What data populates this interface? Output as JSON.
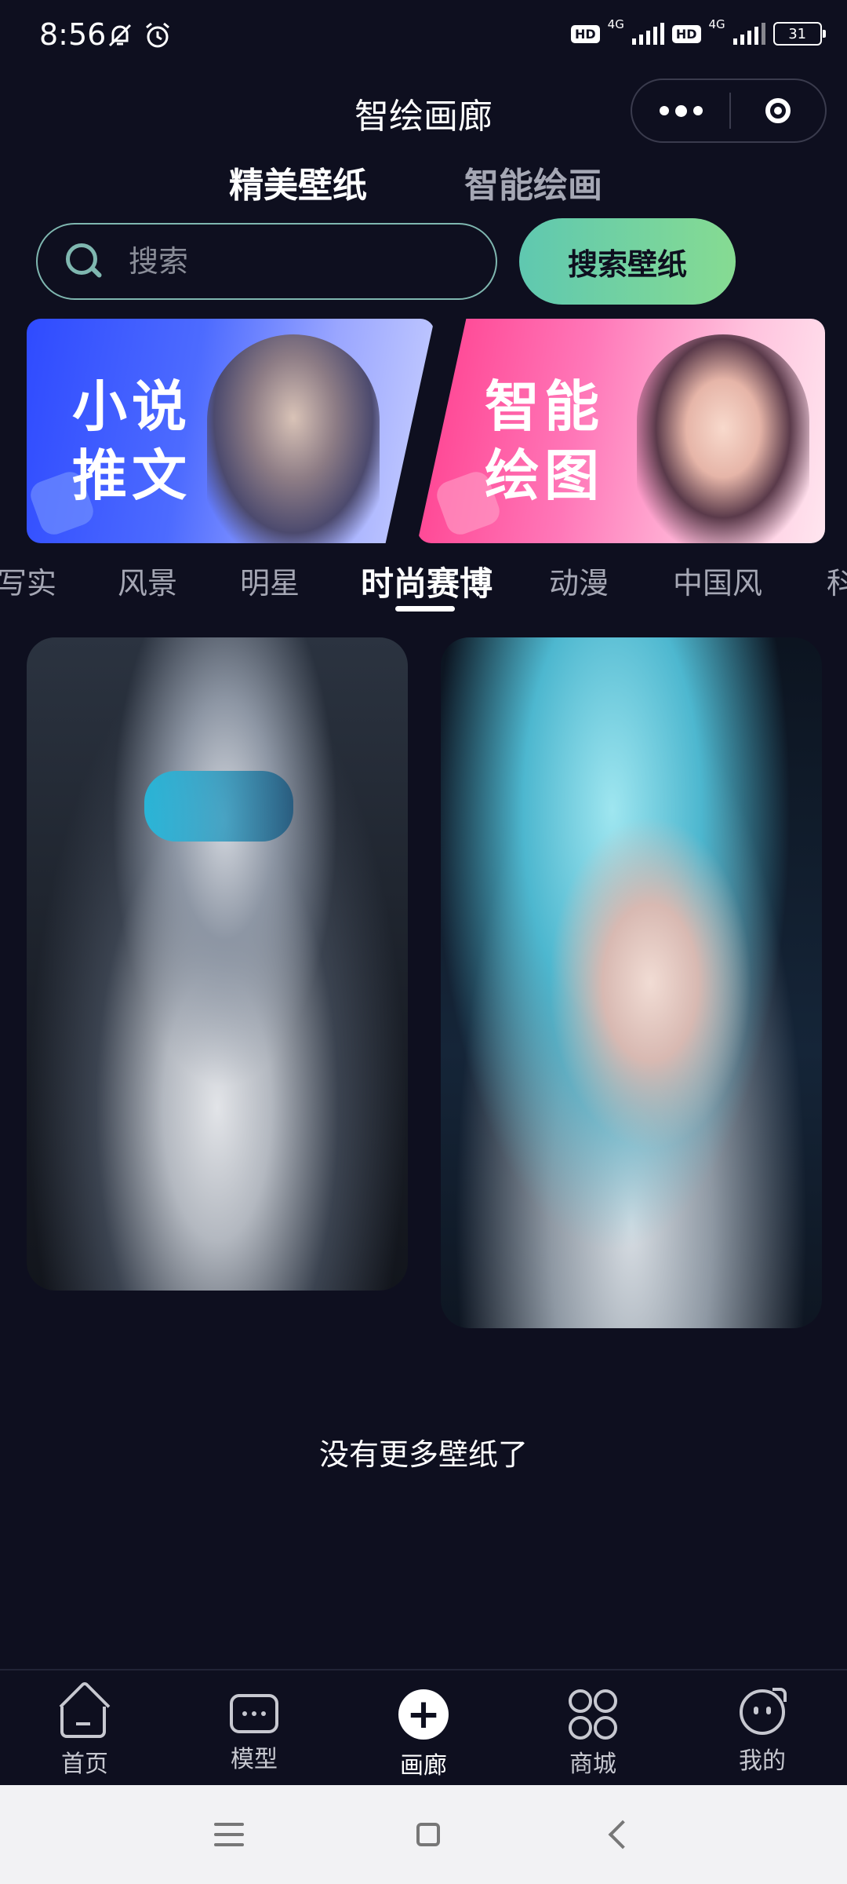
{
  "status_bar": {
    "time": "8:56",
    "hd1": "HD",
    "net1": "4G",
    "hd2": "HD",
    "net2": "4G",
    "battery": "31"
  },
  "header": {
    "title": "智绘画廊"
  },
  "top_tabs": [
    {
      "label": "精美壁纸",
      "active": true
    },
    {
      "label": "智能绘画",
      "active": false
    }
  ],
  "search": {
    "placeholder": "搜索",
    "value": "",
    "button_label": "搜索壁纸"
  },
  "banners": [
    {
      "line1": "小说",
      "line2": "推文"
    },
    {
      "line1": "智能",
      "line2": "绘图"
    }
  ],
  "categories": [
    {
      "label": "写实",
      "active": false
    },
    {
      "label": "风景",
      "active": false
    },
    {
      "label": "明星",
      "active": false
    },
    {
      "label": "时尚赛博",
      "active": true
    },
    {
      "label": "动漫",
      "active": false
    },
    {
      "label": "中国风",
      "active": false
    },
    {
      "label": "科",
      "active": false
    }
  ],
  "gallery": {
    "end_message": "没有更多壁纸了"
  },
  "bottom_nav": [
    {
      "label": "首页",
      "icon": "home-icon",
      "active": false
    },
    {
      "label": "模型",
      "icon": "chat-icon",
      "active": false
    },
    {
      "label": "画廊",
      "icon": "plus-icon",
      "active": true
    },
    {
      "label": "商城",
      "icon": "grid-icon",
      "active": false
    },
    {
      "label": "我的",
      "icon": "face-icon",
      "active": false
    }
  ],
  "colors": {
    "background": "#0e0f1f",
    "accent_gradient_start": "#5fc8b0",
    "accent_gradient_end": "#86db92",
    "inactive_text": "#a5a7b4"
  }
}
